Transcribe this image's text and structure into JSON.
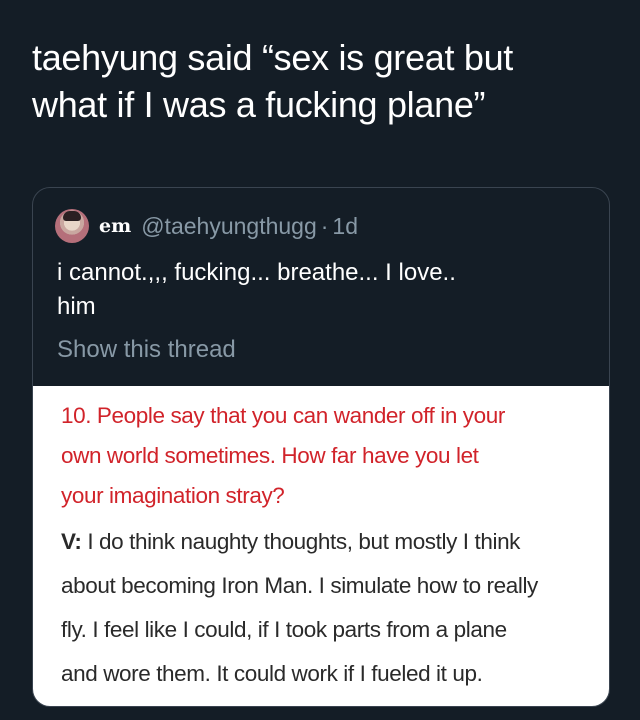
{
  "tweet": {
    "line1": "taehyung said “sex is great but",
    "line2": "what if I was a fucking plane”"
  },
  "quote": {
    "avatar_icon": "profile-photo",
    "display_name": "em",
    "handle": "@taehyungthugg",
    "separator": "·",
    "time": "1d",
    "text_line1": "i cannot.,,, fucking... breathe... I love..",
    "text_line2": "him",
    "show_thread": "Show this thread"
  },
  "image": {
    "question_lines": [
      "10. People say that you can wander off in your",
      "own world sometimes. How far have you let",
      "your imagination stray?"
    ],
    "answer_speaker": "V:",
    "answer_lines": [
      " I do think naughty thoughts, but mostly I think",
      "about becoming Iron Man. I simulate how to really",
      "fly. I feel like I could, if I took parts from a plane",
      "and wore them. It could work if I fueled it up."
    ],
    "question_color": "#d1232a"
  }
}
